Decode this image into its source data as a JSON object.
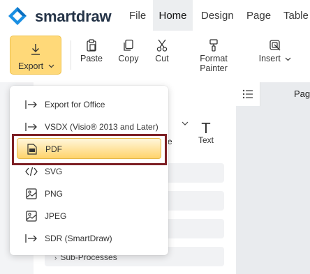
{
  "app": {
    "brand": "smartdraw"
  },
  "menu": {
    "items": [
      {
        "label": "File",
        "active": false
      },
      {
        "label": "Home",
        "active": true
      },
      {
        "label": "Design",
        "active": false
      },
      {
        "label": "Page",
        "active": false
      },
      {
        "label": "Table",
        "active": false
      }
    ]
  },
  "ribbon": {
    "export_label": "Export",
    "paste_label": "Paste",
    "copy_label": "Copy",
    "cut_label": "Cut",
    "format_painter_label": "Format Painter",
    "insert_label": "Insert"
  },
  "panel": {
    "text_tool_glyph": "T",
    "text_tool_label": "Text",
    "partial_label": "e",
    "sub_processes": "Sub-Processes"
  },
  "canvas": {
    "page_label": "Pag"
  },
  "export_menu": {
    "items": [
      {
        "label": "Export for Office",
        "icon": "export-arrow-icon"
      },
      {
        "label": "VSDX (Visio® 2013 and Later)",
        "icon": "export-arrow-icon"
      },
      {
        "label": "PDF",
        "icon": "pdf-file-icon",
        "selected": true
      },
      {
        "label": "SVG",
        "icon": "code-icon"
      },
      {
        "label": "PNG",
        "icon": "image-icon"
      },
      {
        "label": "JPEG",
        "icon": "image-icon"
      },
      {
        "label": "SDR (SmartDraw)",
        "icon": "export-arrow-icon"
      }
    ]
  },
  "colors": {
    "accent": "#ffd979",
    "highlight_border": "#7d1f24",
    "brand_text": "#243347"
  }
}
